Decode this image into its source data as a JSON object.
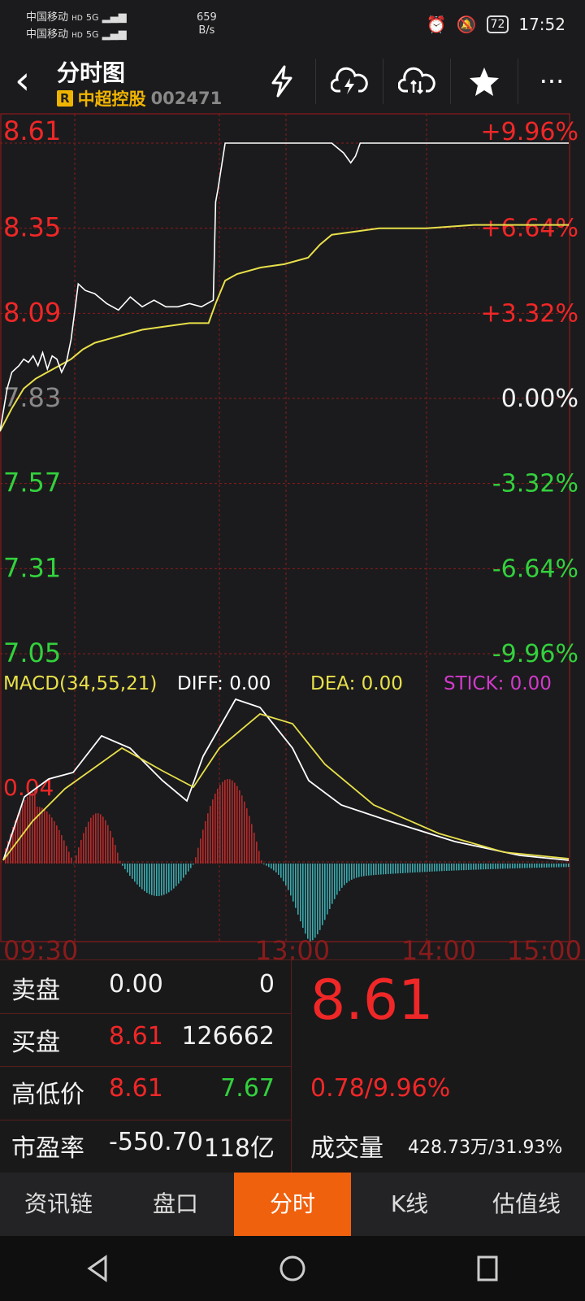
{
  "status": {
    "carrier1": "中国移动",
    "carrier2": "中国移动",
    "hd": "HD",
    "network": "5G",
    "speed_value": "659",
    "speed_unit": "B/s",
    "battery": "72",
    "time": "17:52"
  },
  "header": {
    "title": "分时图",
    "badge": "R",
    "stock_name": "中超控股",
    "stock_code": "002471",
    "icons": [
      "lightning-icon",
      "cloud-lightning-icon",
      "cloud-sync-icon",
      "star-icon",
      "more-icon"
    ],
    "more_label": "···"
  },
  "chart_data": {
    "type": "line",
    "price_axis": [
      "8.61",
      "8.35",
      "8.09",
      "7.83",
      "7.57",
      "7.31",
      "7.05"
    ],
    "pct_axis": [
      "+9.96%",
      "+6.64%",
      "+3.32%",
      "0.00%",
      "-3.32%",
      "-6.64%",
      "-9.96%"
    ],
    "time_labels": [
      "09:30",
      "13:00",
      "14:00",
      "15:00"
    ],
    "ylim": [
      7.05,
      8.61
    ],
    "series": [
      {
        "name": "price",
        "x": [
          0,
          3,
          5,
          8,
          10,
          12,
          14,
          16,
          18,
          20,
          22,
          24,
          26,
          28,
          30,
          33,
          36,
          40,
          45,
          50,
          55,
          60,
          65,
          70,
          75,
          80,
          85,
          90,
          91,
          92,
          95,
          100,
          105,
          108,
          110,
          112,
          115,
          130,
          140,
          145,
          148,
          150,
          152,
          155,
          160,
          200,
          240
        ],
        "y": [
          7.73,
          7.86,
          7.91,
          7.93,
          7.95,
          7.94,
          7.96,
          7.93,
          7.97,
          7.92,
          7.96,
          7.95,
          7.91,
          7.94,
          8.01,
          8.18,
          8.16,
          8.15,
          8.12,
          8.1,
          8.14,
          8.11,
          8.13,
          8.11,
          8.11,
          8.12,
          8.11,
          8.13,
          8.43,
          8.47,
          8.61,
          8.61,
          8.61,
          8.61,
          8.61,
          8.61,
          8.61,
          8.61,
          8.61,
          8.58,
          8.55,
          8.57,
          8.61,
          8.61,
          8.61,
          8.61,
          8.61
        ]
      },
      {
        "name": "average",
        "x": [
          0,
          5,
          10,
          15,
          20,
          25,
          30,
          35,
          40,
          50,
          60,
          70,
          80,
          88,
          91,
          95,
          100,
          110,
          120,
          130,
          135,
          140,
          150,
          160,
          180,
          200,
          220,
          240
        ],
        "y": [
          7.73,
          7.8,
          7.86,
          7.89,
          7.91,
          7.93,
          7.95,
          7.98,
          8.0,
          8.02,
          8.04,
          8.05,
          8.06,
          8.06,
          8.12,
          8.19,
          8.21,
          8.23,
          8.24,
          8.26,
          8.3,
          8.33,
          8.34,
          8.35,
          8.35,
          8.36,
          8.36,
          8.36
        ]
      }
    ]
  },
  "macd": {
    "label": "MACD(34,55,21)",
    "diff": "DIFF: 0.00",
    "dea": "DEA: 0.00",
    "stick": "STICK: 0.00",
    "axis_label": "0.04",
    "diff_color": "#ffffff",
    "dea_color": "#e8e04a",
    "stick_color": "#d13aca"
  },
  "quote": {
    "sell_label": "卖盘",
    "sell_price": "0.00",
    "sell_vol": "0",
    "buy_label": "买盘",
    "buy_price": "8.61",
    "buy_vol": "126662",
    "hilo_label": "高低价",
    "high": "8.61",
    "low": "7.67",
    "pe_label": "市盈率",
    "pe": "-550.70",
    "mcap": "118亿",
    "last_price": "8.61",
    "change": "0.78/9.96%",
    "volume_label": "成交量",
    "volume": "428.73万/31.93%"
  },
  "tabs": [
    {
      "label": "资讯链",
      "active": false
    },
    {
      "label": "盘口",
      "active": false
    },
    {
      "label": "分时",
      "active": true
    },
    {
      "label": "K线",
      "active": false
    },
    {
      "label": "估值线",
      "active": false
    }
  ],
  "colors": {
    "up": "#f02727",
    "down": "#33d13d",
    "accent": "#f0610e",
    "grid": "#8a1b1b"
  }
}
